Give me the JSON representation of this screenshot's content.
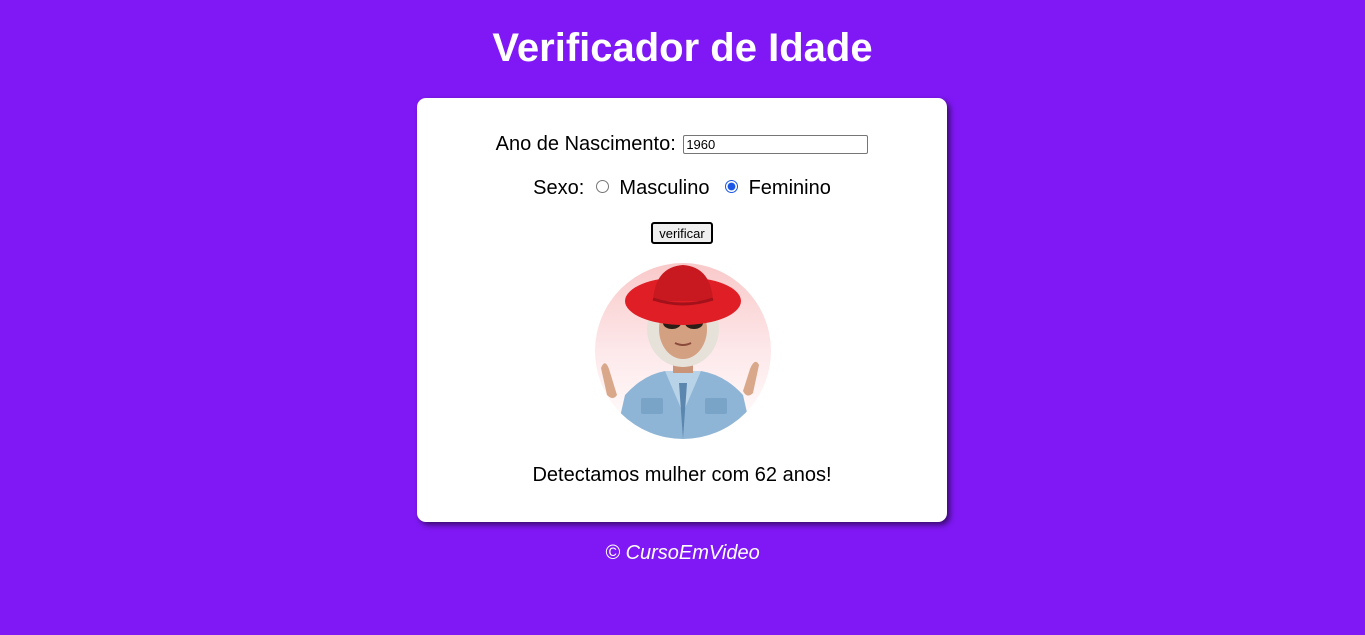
{
  "header": {
    "title": "Verificador de Idade"
  },
  "form": {
    "year_label": "Ano de Nascimento:",
    "year_value": "1960",
    "sex_label": "Sexo:",
    "sex_options": [
      {
        "label": "Masculino",
        "checked": false
      },
      {
        "label": "Feminino",
        "checked": true
      }
    ],
    "verify_button": "verificar"
  },
  "result": {
    "image_icon": "elderly-woman-photo",
    "text": "Detectamos mulher com 62 anos!"
  },
  "footer": {
    "text": "© CursoEmVideo"
  },
  "colors": {
    "background": "#7f18f4",
    "card": "#ffffff",
    "radio_accent": "#1a57e6"
  }
}
